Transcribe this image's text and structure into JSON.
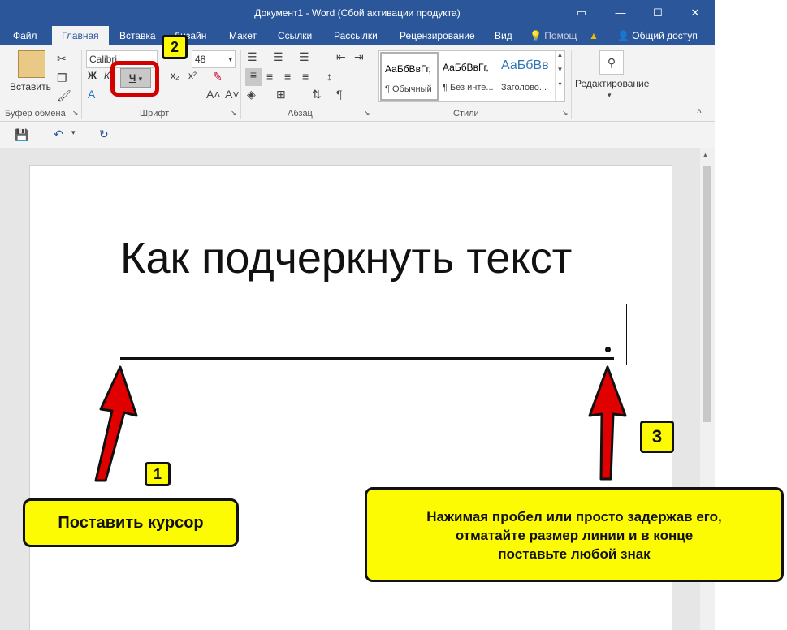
{
  "window": {
    "title": "Документ1 - Word (Сбой активации продукта)"
  },
  "tabs": [
    "Файл",
    "Главная",
    "Вставка",
    "Дизайн",
    "Макет",
    "Ссылки",
    "Рассылки",
    "Рецензирование",
    "Вид"
  ],
  "tell_me": "Помощ",
  "share": "Общий доступ",
  "clipboard": {
    "paste": "Вставить",
    "label": "Буфер обмена"
  },
  "font": {
    "name": "Calibri",
    "size": "48",
    "label": "Шрифт",
    "bold": "Ж",
    "italic": "К",
    "underline": "Ч",
    "subscript": "x₂",
    "superscript": "x²"
  },
  "paragraph": {
    "label": "Абзац"
  },
  "styles": {
    "label": "Стили",
    "items": [
      {
        "sample": "АаБбВвГг,",
        "name": "¶ Обычный"
      },
      {
        "sample": "АаБбВвГг,",
        "name": "¶ Без инте..."
      },
      {
        "sample": "АаБбВв",
        "name": "Заголово..."
      }
    ]
  },
  "editing": {
    "label": "Редактирование"
  },
  "document": {
    "heading": "Как подчеркнуть текст"
  },
  "annotations": {
    "badge1": "1",
    "badge2": "2",
    "badge3": "3",
    "callout1": "Поставить курсор",
    "callout3_line1": "Нажимая пробел или просто задержав его,",
    "callout3_line2": "отматайте размер линии и в конце",
    "callout3_line3": "поставьте любой знак",
    "highlight_color": "#d40000",
    "callout_color": "#fdfb03"
  }
}
